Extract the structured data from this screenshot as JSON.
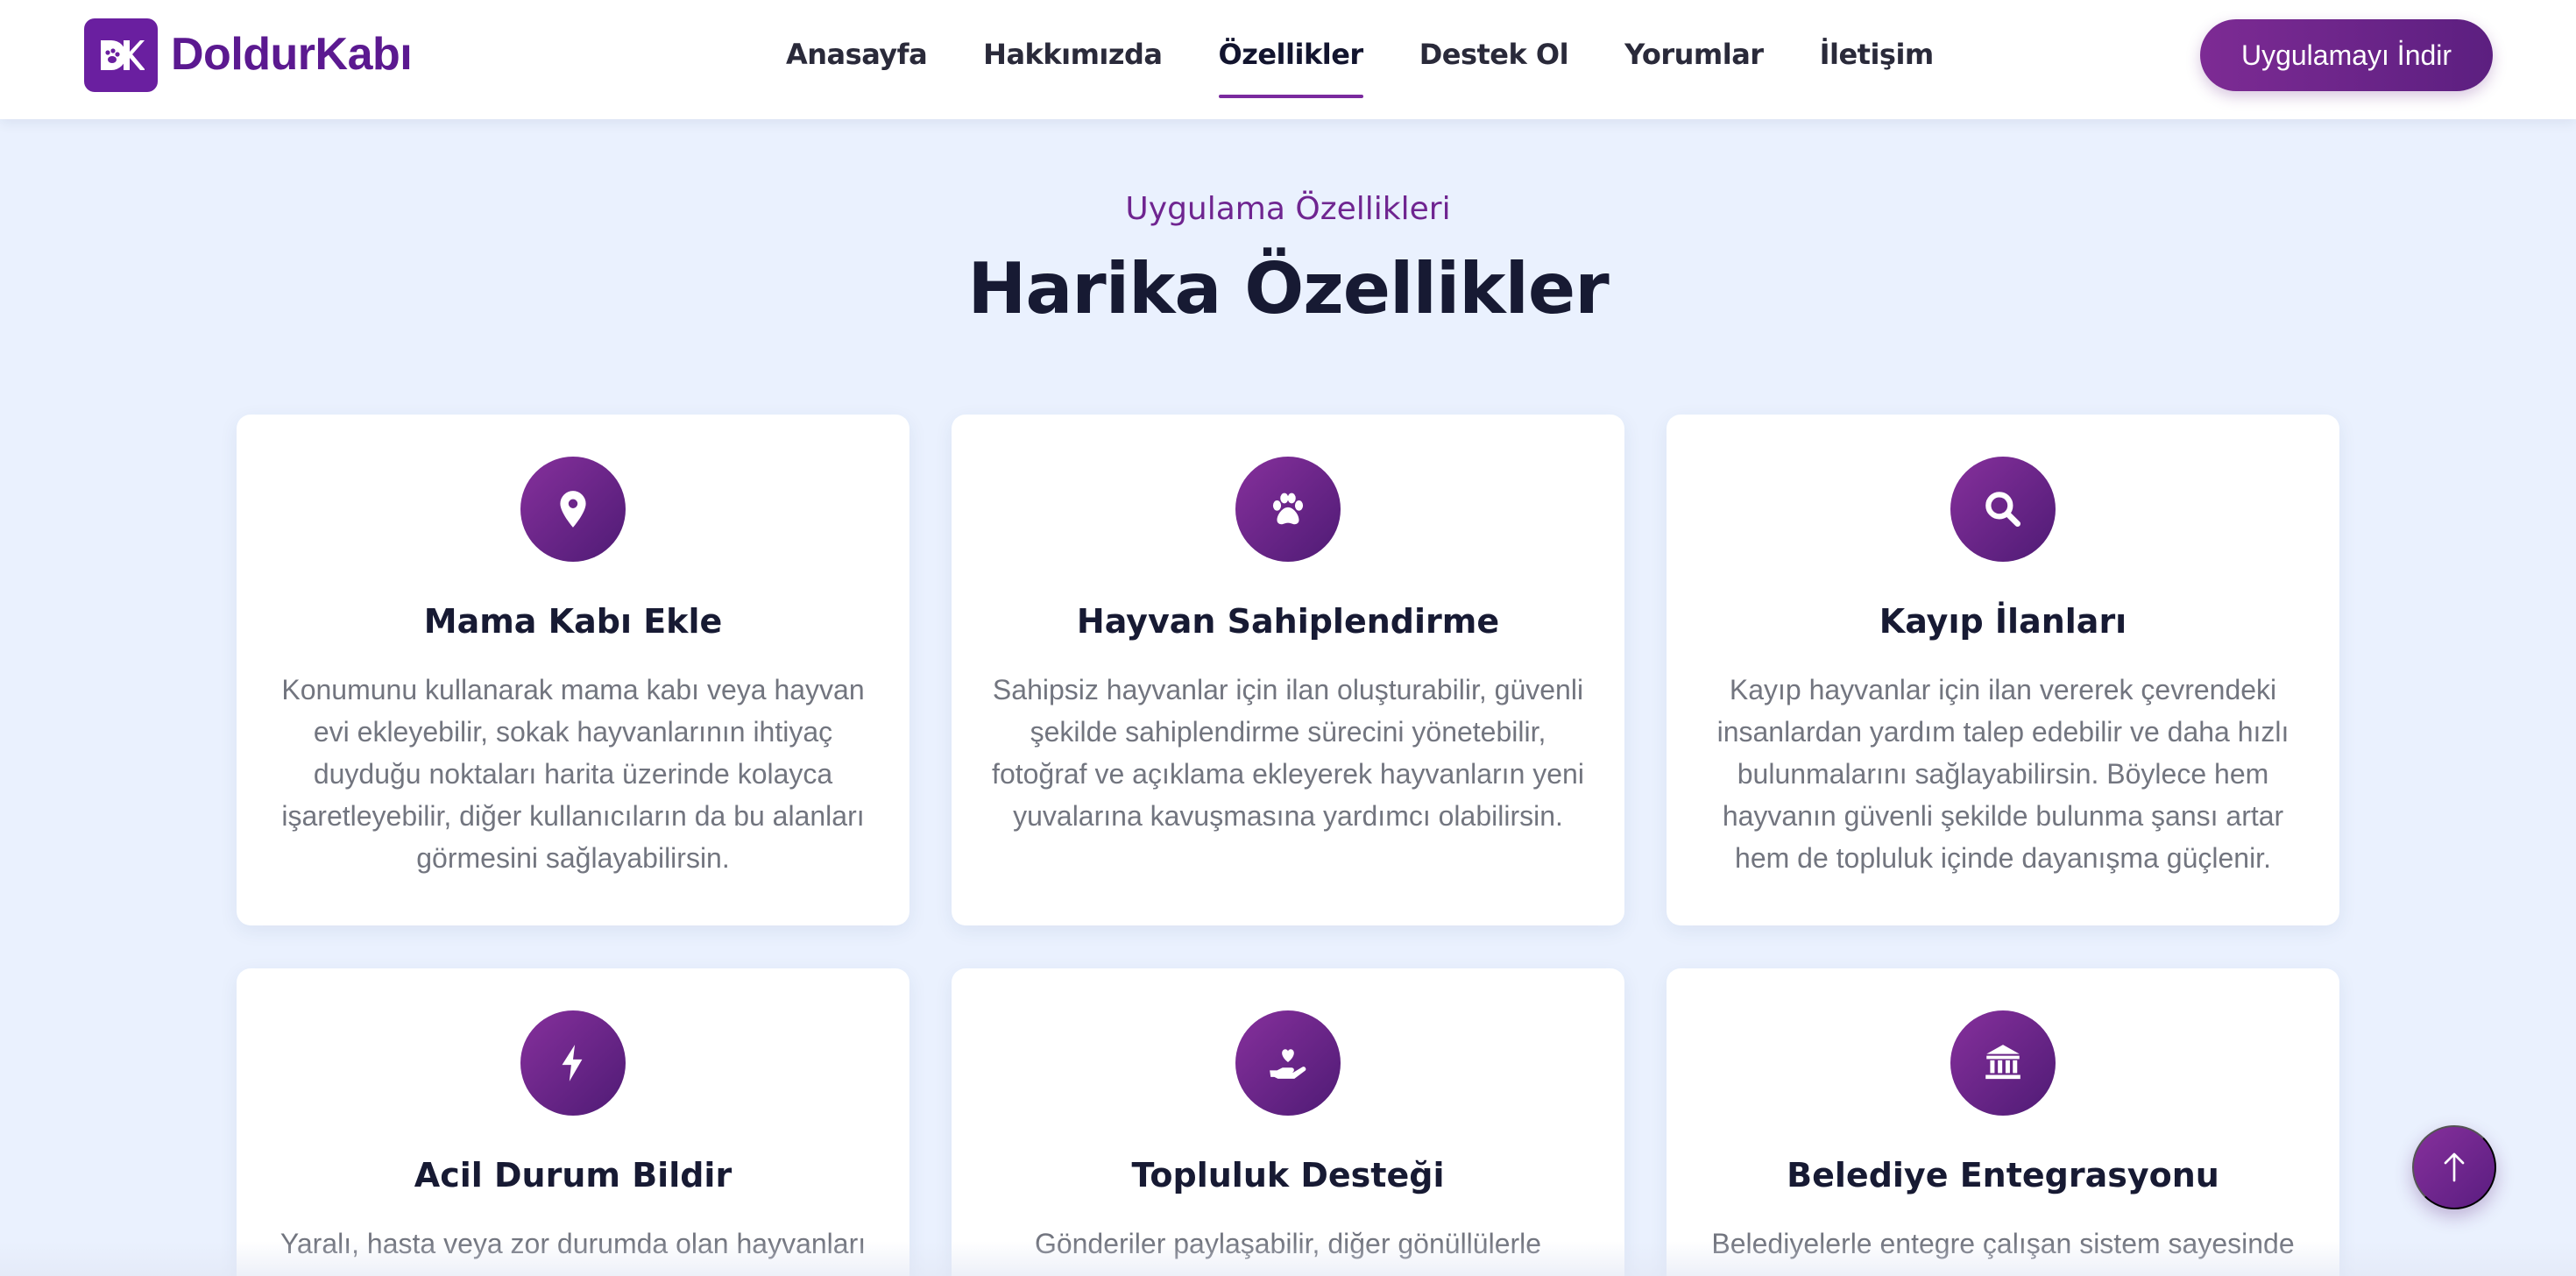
{
  "brand": {
    "name": "DoldurKabı",
    "logo_letters": "DK",
    "color": "#5b1990"
  },
  "nav": {
    "items": [
      {
        "label": "Anasayfa"
      },
      {
        "label": "Hakkımızda"
      },
      {
        "label": "Özellikler",
        "active": true
      },
      {
        "label": "Destek Ol"
      },
      {
        "label": "Yorumlar"
      },
      {
        "label": "İletişim"
      }
    ]
  },
  "header": {
    "cta_label": "Uygulamayı İndir"
  },
  "section": {
    "eyebrow": "Uygulama Özellikleri",
    "title": "Harika Özellikler"
  },
  "features": [
    {
      "icon": "map-pin-icon",
      "title": "Mama Kabı Ekle",
      "description": "Konumunu kullanarak mama kabı veya hayvan evi ekleyebilir, sokak hayvanlarının ihtiyaç duyduğu noktaları harita üzerinde kolayca işaretleyebilir, diğer kullanıcıların da bu alanları görmesini sağlayabilirsin."
    },
    {
      "icon": "paw-icon",
      "title": "Hayvan Sahiplendirme",
      "description": "Sahipsiz hayvanlar için ilan oluşturabilir, güvenli şekilde sahiplendirme sürecini yönetebilir, fotoğraf ve açıklama ekleyerek hayvanların yeni yuvalarına kavuşmasına yardımcı olabilirsin."
    },
    {
      "icon": "search-icon",
      "title": "Kayıp İlanları",
      "description": "Kayıp hayvanlar için ilan vererek çevrendeki insanlardan yardım talep edebilir ve daha hızlı bulunmalarını sağlayabilirsin. Böylece hem hayvanın güvenli şekilde bulunma şansı artar hem de topluluk içinde dayanışma güçlenir."
    },
    {
      "icon": "bolt-icon",
      "title": "Acil Durum Bildir",
      "description": "Yaralı, hasta veya zor durumda olan hayvanları"
    },
    {
      "icon": "hand-heart-icon",
      "title": "Topluluk Desteği",
      "description": "Gönderiler paylaşabilir, diğer gönüllülerle"
    },
    {
      "icon": "bank-icon",
      "title": "Belediye Entegrasyonu",
      "description": "Belediyelerle entegre çalışan sistem sayesinde"
    }
  ],
  "scroll_top": {
    "icon": "arrow-up-icon",
    "glyph": "↑"
  }
}
